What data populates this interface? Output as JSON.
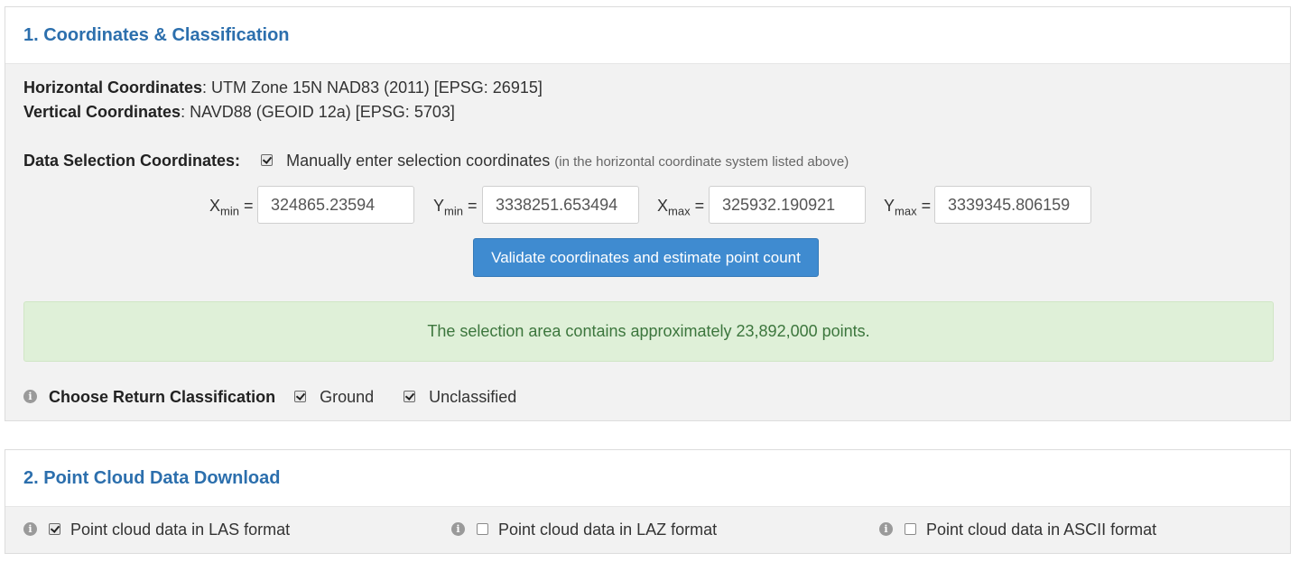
{
  "section1": {
    "title": "1. Coordinates & Classification",
    "horizontal_label": "Horizontal Coordinates",
    "horizontal_value": ": UTM Zone 15N NAD83 (2011) [EPSG: 26915]",
    "vertical_label": "Vertical Coordinates",
    "vertical_value": ": NAVD88 (GEOID 12a) [EPSG: 5703]",
    "selection_label": "Data Selection Coordinates:",
    "manual_checked": true,
    "manual_label": "Manually enter selection coordinates",
    "manual_note": "(in the horizontal coordinate system listed above)",
    "coords": {
      "xmin": {
        "letter": "X",
        "sub": "min",
        "eq": "=",
        "value": "324865.23594"
      },
      "ymin": {
        "letter": "Y",
        "sub": "min",
        "eq": "=",
        "value": "3338251.653494"
      },
      "xmax": {
        "letter": "X",
        "sub": "max",
        "eq": "=",
        "value": "325932.190921"
      },
      "ymax": {
        "letter": "Y",
        "sub": "max",
        "eq": "=",
        "value": "3339345.806159"
      }
    },
    "validate_button": "Validate coordinates and estimate point count",
    "alert_text": "The selection area contains approximately 23,892,000 points.",
    "classification_label": "Choose Return Classification",
    "ground_label": "Ground",
    "ground_checked": true,
    "unclassified_label": "Unclassified",
    "unclassified_checked": true,
    "info_icon_glyph": "i"
  },
  "section2": {
    "title": "2. Point Cloud Data Download",
    "options": [
      {
        "label": "Point cloud data in LAS format",
        "checked": true
      },
      {
        "label": "Point cloud data in LAZ format",
        "checked": false
      },
      {
        "label": "Point cloud data in ASCII format",
        "checked": false
      }
    ]
  },
  "colors": {
    "heading": "#2c6fad",
    "button": "#3f8bd0",
    "alert_bg": "#dff0d8",
    "alert_text": "#3c763d"
  }
}
